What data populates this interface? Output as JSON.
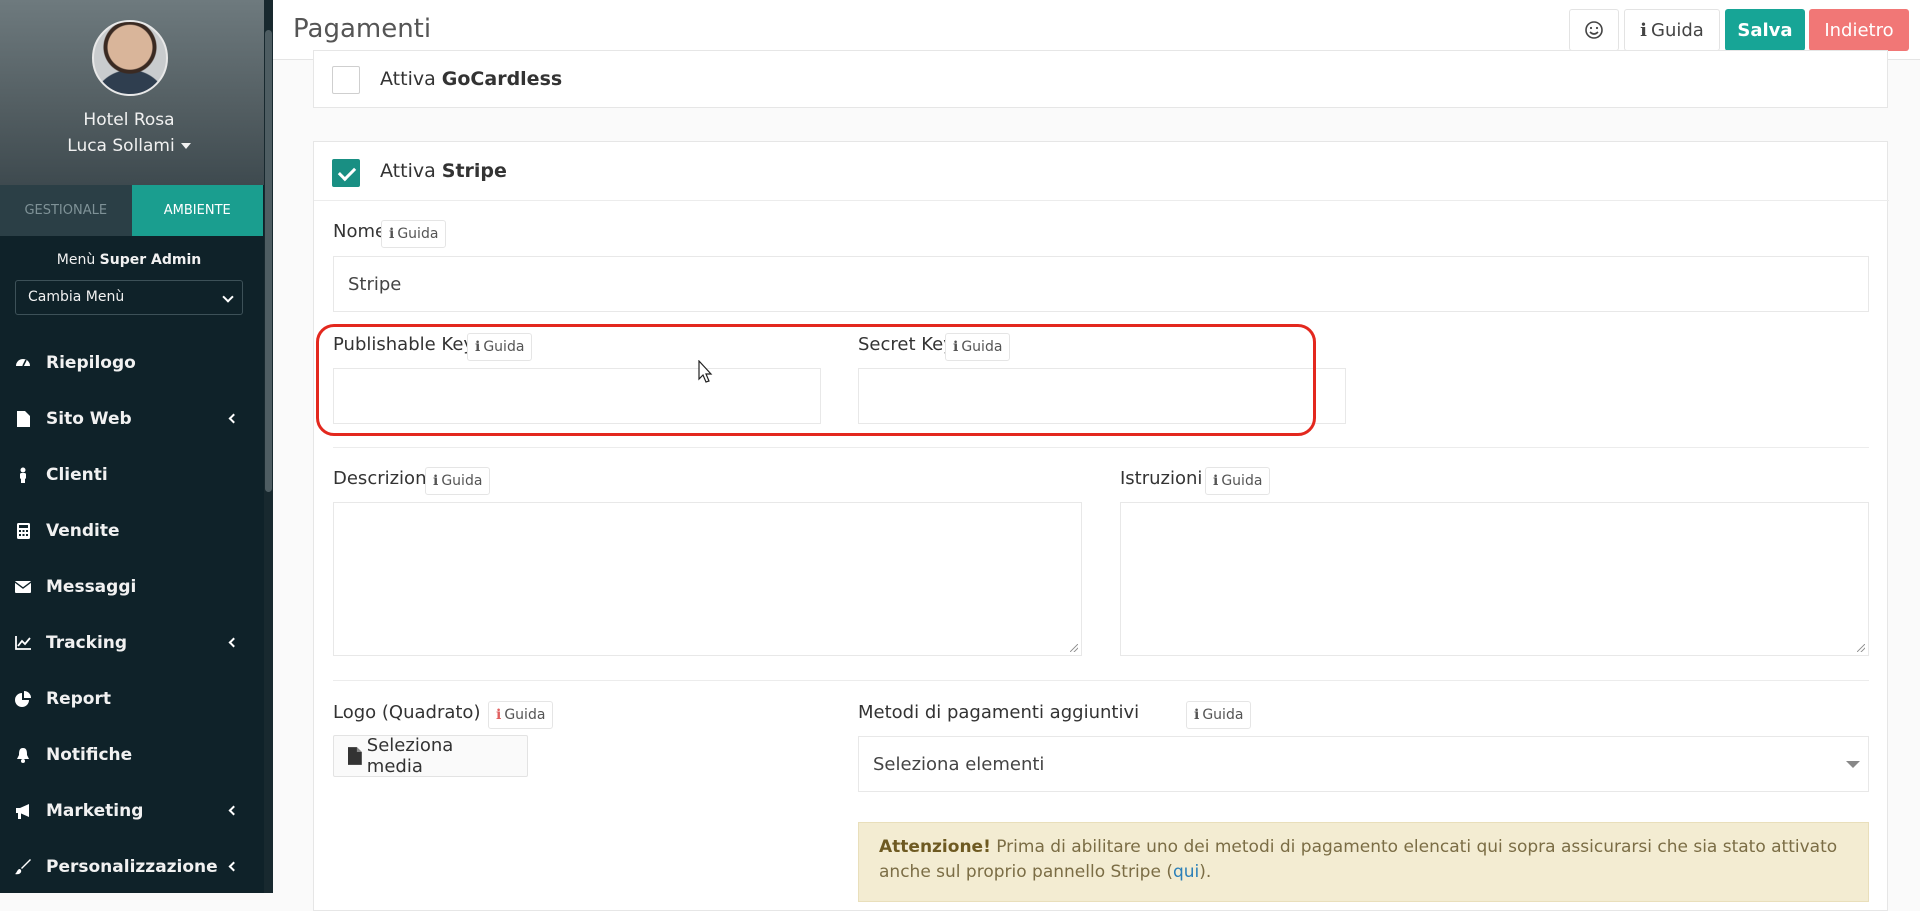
{
  "sidebar": {
    "hotel": "Hotel Rosa",
    "user": "Luca Sollami",
    "tabs": [
      "GESTIONALE",
      "AMBIENTE"
    ],
    "menu_prefix": "Menù",
    "menu_role": "Super Admin",
    "menu_select": "Cambia Menù",
    "items": [
      {
        "label": "Riepilogo",
        "icon": "dashboard-icon",
        "arrow": false
      },
      {
        "label": "Sito Web",
        "icon": "file-icon",
        "arrow": true
      },
      {
        "label": "Clienti",
        "icon": "person-icon",
        "arrow": false
      },
      {
        "label": "Vendite",
        "icon": "calculator-icon",
        "arrow": false
      },
      {
        "label": "Messaggi",
        "icon": "envelope-icon",
        "arrow": false
      },
      {
        "label": "Tracking",
        "icon": "line-chart-icon",
        "arrow": true
      },
      {
        "label": "Report",
        "icon": "pie-chart-icon",
        "arrow": false
      },
      {
        "label": "Notifiche",
        "icon": "bell-icon",
        "arrow": false
      },
      {
        "label": "Marketing",
        "icon": "megaphone-icon",
        "arrow": true
      },
      {
        "label": "Personalizzazione",
        "icon": "brush-icon",
        "arrow": true
      }
    ]
  },
  "header": {
    "title": "Pagamenti",
    "emoji_icon": "smile-icon",
    "guida": "Guida",
    "save": "Salva",
    "back": "Indietro"
  },
  "gocardless": {
    "prefix": "Attiva",
    "name": "GoCardless",
    "checked": false
  },
  "stripe": {
    "prefix": "Attiva",
    "name": "Stripe",
    "checked": true,
    "nome_label": "Nome",
    "nome_value": "Stripe",
    "publishable_label": "Publishable Key",
    "publishable_value": "",
    "secret_label": "Secret Key",
    "secret_value": "",
    "descrizione_label": "Descrizione",
    "istruzioni_label": "Istruzioni",
    "logo_label": "Logo (Quadrato)",
    "media_button": "Seleziona media",
    "metodi_label": "Metodi di pagamenti aggiuntivi",
    "metodi_placeholder": "Seleziona elementi",
    "guida": "Guida"
  },
  "alert": {
    "title": "Attenzione!",
    "text": " Prima di abilitare uno dei metodi di pagamento elencati qui sopra assicurarsi che sia stato attivato anche sul proprio pannello Stripe (",
    "link": "qui",
    "end": ")."
  },
  "colors": {
    "accent": "#17a596",
    "danger": "#f17776",
    "highlight": "#e3281e",
    "sidebar": "#0f2229"
  }
}
